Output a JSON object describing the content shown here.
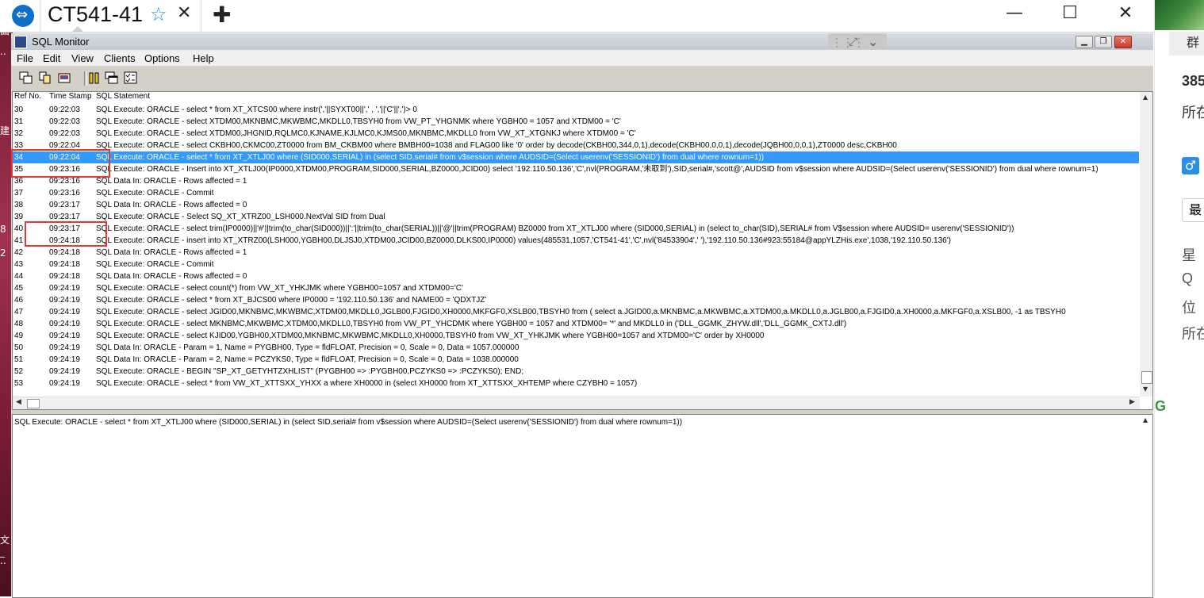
{
  "remote_tab": {
    "title": "CT541-41",
    "star": "☆",
    "close": "✕",
    "add": "✚"
  },
  "window_controls": {
    "minimize": "—",
    "maximize": "☐",
    "close": "✕"
  },
  "sql_monitor": {
    "title": "SQL Monitor",
    "menu": [
      "File",
      "Edit",
      "View",
      "Clients",
      "Options",
      "Help"
    ],
    "columns": [
      "Ref No.",
      "Time Stamp",
      "SQL Statement"
    ],
    "rows": [
      [
        "30",
        "09:22:03",
        "SQL Execute: ORACLE - select * from XT_XTCS00 where instr(','||SYXT00||',' , ','||'C'||',')> 0"
      ],
      [
        "31",
        "09:22:03",
        "SQL Execute: ORACLE - select XTDM00,MKNBMC,MKWBMC,MKDLL0,TBSYH0 from VW_PT_YHGNMK where YGBH00 = 1057 and XTDM00 = 'C'"
      ],
      [
        "32",
        "09:22:03",
        "SQL Execute: ORACLE - select XTDM00,JHGNID,RQLMC0,KJNAME,KJLMC0,KJMS00,MKNBMC,MKDLL0 from VW_XT_XTGNKJ where XTDM00 = 'C'"
      ],
      [
        "33",
        "09:22:04",
        "SQL Execute: ORACLE - select CKBH00,CKMC00,ZT0000 from BM_CKBM00 where BMBH00=1038 and FLAG00 like '0' order by decode(CKBH00,344,0,1),decode(CKBH00,0,0,1),decode(JQBH00,0,0,1),ZT0000 desc,CKBH00"
      ],
      [
        "34",
        "09:22:04",
        "SQL Execute: ORACLE - select * from XT_XTLJ00 where (SID000,SERIAL) in (select SID,serial# from  v$session where AUDSID=(Select userenv('SESSIONID') from dual where rownum=1))"
      ],
      [
        "35",
        "09:23:16",
        "SQL Execute: ORACLE - Insert into XT_XTLJ00(IP0000,XTDM00,PROGRAM,SID000,SERIAL,BZ0000,JCID00)  select '192.110.50.136','C',nvl(PROGRAM,'未取到'),SID,serial#,'scott@',AUDSID from v$session where  AUDSID=(Select userenv('SESSIONID') from dual where rownum=1)"
      ],
      [
        "36",
        "09:23:16",
        "SQL Data In: ORACLE - Rows affected = 1"
      ],
      [
        "37",
        "09:23:16",
        "SQL Execute: ORACLE - Commit"
      ],
      [
        "38",
        "09:23:17",
        "SQL Data In: ORACLE - Rows affected = 0"
      ],
      [
        "39",
        "09:23:17",
        "SQL Execute: ORACLE -  Select SQ_XT_XTRZ00_LSH000.NextVal SID from Dual"
      ],
      [
        "40",
        "09:23:17",
        "SQL Execute: ORACLE - select trim(IP0000)||'#'||trim(to_char(SID000))||':'||trim(to_char(SERIAL))||'@'||trim(PROGRAM) BZ0000  from XT_XTLJ00 where (SID000,SERIAL) in (select to_char(SID),SERIAL# from V$session where  AUDSID= userenv('SESSIONID'))"
      ],
      [
        "41",
        "09:24:18",
        "SQL Execute: ORACLE - insert into XT_XTRZ00(LSH000,YGBH00,DLJSJ0,XTDM00,JCID00,BZ0000,DLKS00,IP0000)  values(485531,1057,'CT541-41','C',nvl('84533904',' '),'192.110.50.136#923:55184@appYLZHis.exe',1038,'192.110.50.136')"
      ],
      [
        "42",
        "09:24:18",
        "SQL Data In: ORACLE - Rows affected = 1"
      ],
      [
        "43",
        "09:24:18",
        "SQL Execute: ORACLE - Commit"
      ],
      [
        "44",
        "09:24:18",
        "SQL Data In: ORACLE - Rows affected = 0"
      ],
      [
        "45",
        "09:24:19",
        "SQL Execute: ORACLE - select count(*) from VW_XT_YHKJMK  where YGBH00=1057 and XTDM00='C'"
      ],
      [
        "46",
        "09:24:19",
        "SQL Execute: ORACLE - select * from XT_BJCS00 where IP0000 = '192.110.50.136' and NAME00 = 'QDXTJZ'"
      ],
      [
        "47",
        "09:24:19",
        "SQL Execute: ORACLE -  select JGID00,MKNBMC,MKWBMC,XTDM00,MKDLL0,JGLB00,FJGID0,XH0000,MKFGF0,XSLB00,TBSYH0  from (  select a.JGID00,a.MKNBMC,a.MKWBMC,a.XTDM00,a.MKDLL0,a.JGLB00,a.FJGID0,a.XH0000,a.MKFGF0,a.XSLB00, -1 as TBSYH0"
      ],
      [
        "48",
        "09:24:19",
        "SQL Execute: ORACLE - select MKNBMC,MKWBMC,XTDM00,MKDLL0,TBSYH0 from VW_PT_YHCDMK where YGBH00 = 1057 and XTDM00= '*' and MKDLL0 in ('DLL_GGMK_ZHYW.dll','DLL_GGMK_CXTJ.dll')"
      ],
      [
        "49",
        "09:24:19",
        "SQL Execute: ORACLE - select KJID00,YGBH00,XTDM00,MKNBMC,MKWBMC,MKDLL0,XH0000,TBSYH0 from VW_XT_YHKJMK  where YGBH00=1057 and XTDM00='C' order by XH0000"
      ],
      [
        "50",
        "09:24:19",
        "SQL Data In: ORACLE - Param = 1, Name = PYGBH00, Type = fldFLOAT, Precision = 0, Scale = 0, Data = 1057.000000"
      ],
      [
        "51",
        "09:24:19",
        "SQL Data In: ORACLE - Param = 2, Name = PCZYKS0, Type = fldFLOAT, Precision = 0, Scale = 0, Data = 1038.000000"
      ],
      [
        "52",
        "09:24:19",
        "SQL Execute: ORACLE - BEGIN \"SP_XT_GETYHTZXHLIST\" (PYGBH00 => :PYGBH00,PCZYKS0 => :PCZYKS0); END;"
      ],
      [
        "53",
        "09:24:19",
        "SQL Execute: ORACLE - select * from VW_XT_XTTSXX_YHXX a where XH0000 in (select XH0000 from XT_XTTSXX_XHTEMP where CZYBH0 = 1057)"
      ]
    ],
    "selected_ref": "34",
    "detail_text": "SQL Execute: ORACLE - select * from XT_XTLJ00 where (SID000,SERIAL) in (select SID,serial# from  v$session where AUDSID=(Select userenv('SESSIONID') from dual where rownum=1))"
  },
  "desktop_left_glyphs": [
    "面",
    "..",
    "建",
    "8",
    "2",
    "文_",
    ".."
  ],
  "right_panel": {
    "tab": "群",
    "number": "385",
    "label1": "所在",
    "gender": "♂",
    "button": "最",
    "items": [
      "星",
      "Q",
      "位",
      "所在"
    ],
    "green_char": "G"
  },
  "colors": {
    "selection": "#3399ff",
    "highlight_box": "#e03a3a",
    "teamviewer_blue": "#0e6fc8",
    "star_blue": "#2b8fe6"
  }
}
